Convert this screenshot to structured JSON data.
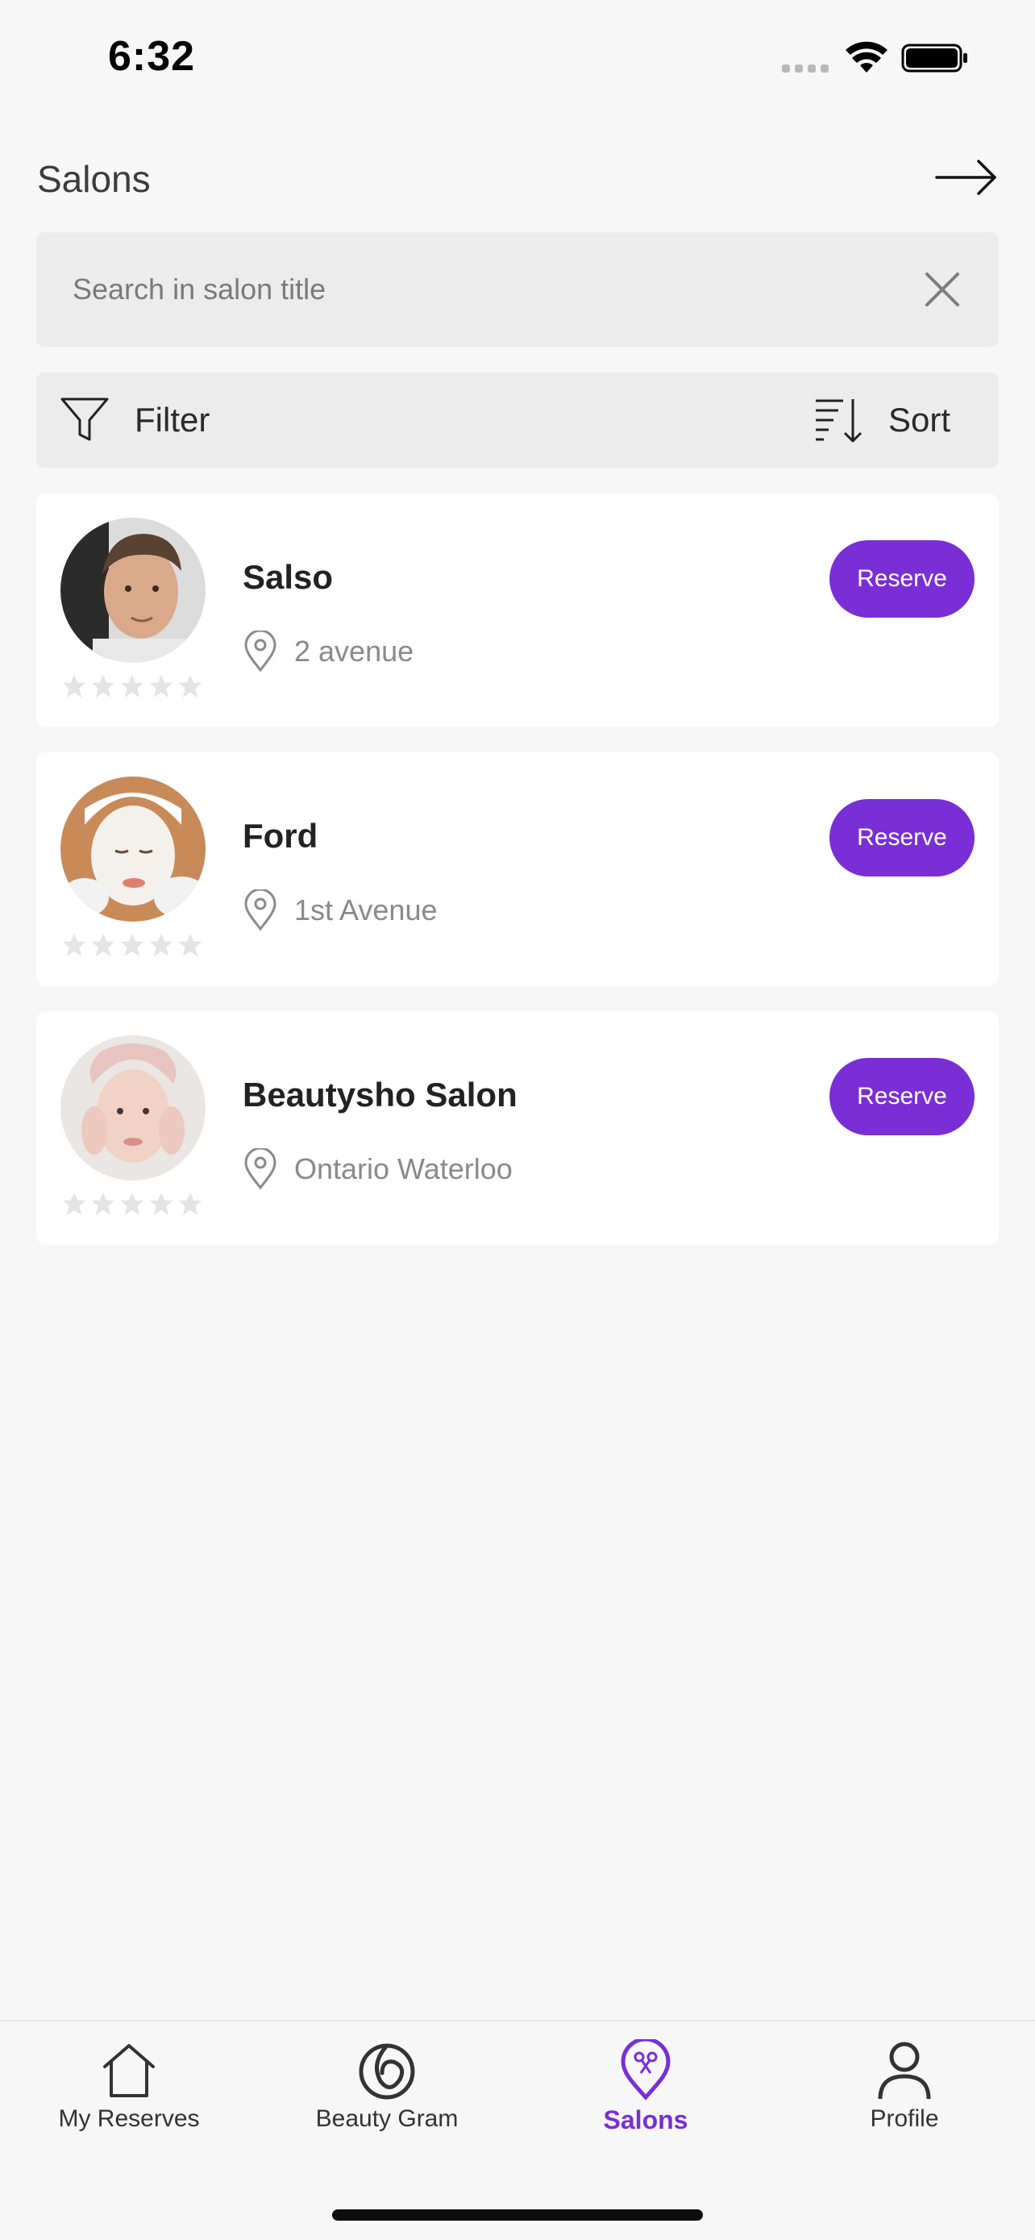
{
  "status_bar": {
    "time": "6:32"
  },
  "header": {
    "title": "Salons"
  },
  "search": {
    "placeholder": "Search in salon title",
    "value": ""
  },
  "toolbar": {
    "filter_label": "Filter",
    "sort_label": "Sort"
  },
  "salons": [
    {
      "name": "Salso",
      "address": "2 avenue",
      "reserve_label": "Reserve",
      "rating": 0
    },
    {
      "name": "Ford",
      "address": "1st Avenue",
      "reserve_label": "Reserve",
      "rating": 0
    },
    {
      "name": "Beautysho Salon",
      "address": "Ontario Waterloo",
      "reserve_label": "Reserve",
      "rating": 0
    }
  ],
  "tabs": [
    {
      "label": "My Reserves",
      "icon": "home-icon"
    },
    {
      "label": "Beauty Gram",
      "icon": "beauty-gram-icon"
    },
    {
      "label": "Salons",
      "icon": "salon-pin-icon",
      "active": true
    },
    {
      "label": "Profile",
      "icon": "profile-icon"
    }
  ],
  "colors": {
    "accent": "#7a2ed6",
    "background": "#f7f7f7",
    "card": "#ffffff",
    "bar": "#ececec"
  }
}
